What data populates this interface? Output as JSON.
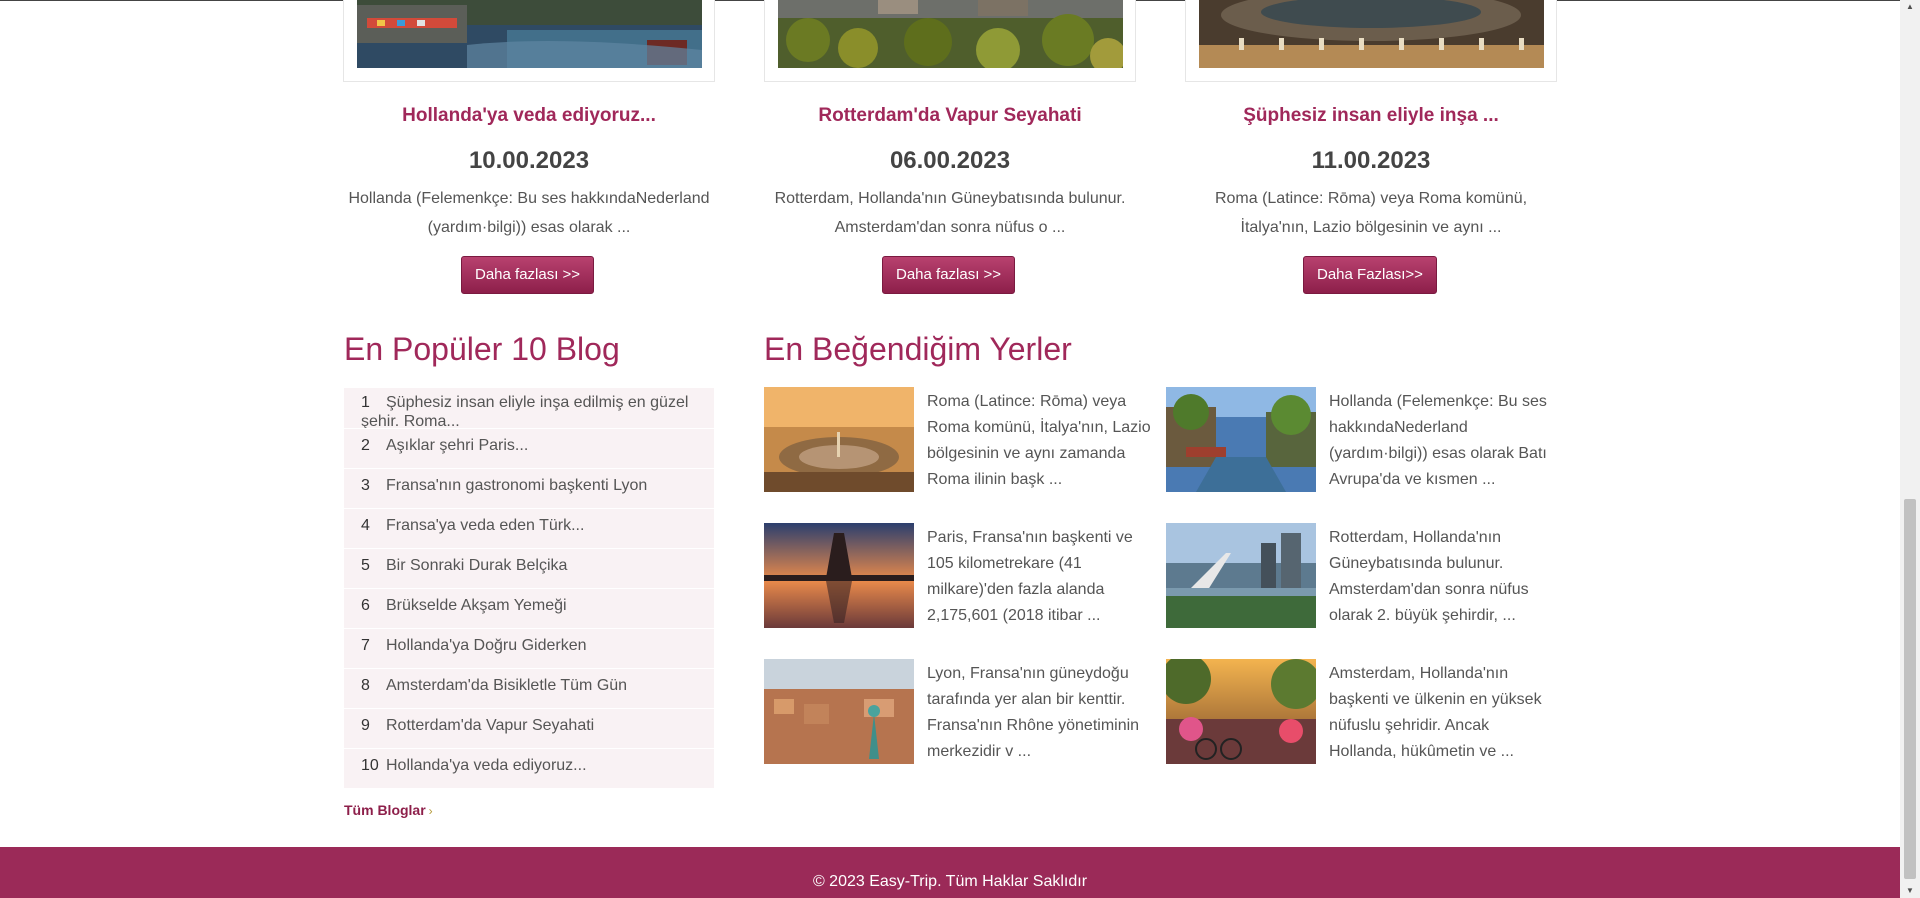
{
  "cards": [
    {
      "title": "Hollanda'ya veda ediyoruz...",
      "date": "10.00.2023",
      "excerpt": "Hollanda (Felemenkçe: Bu ses hakkındaNederland (yardım·bilgi)) esas olarak ...",
      "button": "Daha fazlası >>"
    },
    {
      "title": "Rotterdam'da Vapur Seyahati",
      "date": "06.00.2023",
      "excerpt": "Rotterdam, Hollanda'nın Güneybatısında bulunur. Amsterdam'dan sonra nüfus o ...",
      "button": "Daha fazlası >>"
    },
    {
      "title": "Şüphesiz insan eliyle inşa ...",
      "date": "11.00.2023",
      "excerpt": "Roma (Latince: Rōma) veya Roma komünü, İtalya'nın, Lazio bölgesinin ve aynı ...",
      "button": "Daha Fazlası>>"
    }
  ],
  "popular": {
    "title": "En Popüler 10 Blog",
    "items": [
      {
        "num": "1",
        "text": "Şüphesiz insan eliyle inşa edilmiş en güzel şehir. Roma..."
      },
      {
        "num": "2",
        "text": "Aşıklar şehri Paris..."
      },
      {
        "num": "3",
        "text": "Fransa'nın gastronomi başkenti Lyon"
      },
      {
        "num": "4",
        "text": "Fransa'ya veda eden Türk..."
      },
      {
        "num": "5",
        "text": "Bir Sonraki Durak Belçika"
      },
      {
        "num": "6",
        "text": "Brükselde Akşam Yemeği"
      },
      {
        "num": "7",
        "text": "Hollanda'ya Doğru Giderken"
      },
      {
        "num": "8",
        "text": "Amsterdam'da Bisikletle Tüm Gün"
      },
      {
        "num": "9",
        "text": "Rotterdam'da Vapur Seyahati"
      },
      {
        "num": "10",
        "text": "Hollanda'ya veda ediyoruz..."
      }
    ],
    "all_link": "Tüm Bloglar",
    "all_arrow": "›"
  },
  "favorites": {
    "title": "En Beğendiğim Yerler",
    "items": [
      {
        "text": "Roma (Latince: Rōma) veya Roma komünü, İtalya'nın, Lazio bölgesinin ve aynı zamanda Roma ilinin başk ..."
      },
      {
        "text": "Hollanda (Felemenkçe: Bu ses hakkındaNederland (yardım·bilgi)) esas olarak Batı Avrupa'da ve kısmen ..."
      },
      {
        "text": "Paris, Fransa'nın başkenti ve 105 kilometrekare (41 milkare)'den fazla alanda 2,175,601 (2018 itibar ..."
      },
      {
        "text": "Rotterdam, Hollanda'nın Güneybatısında bulunur. Amsterdam'dan sonra nüfus olarak 2. büyük şehirdir, ..."
      },
      {
        "text": "Lyon, Fransa'nın güneydoğu tarafında yer alan bir kenttir. Fransa'nın Rhône yönetiminin merkezidir v ..."
      },
      {
        "text": "Amsterdam, Hollanda'nın başkenti ve ülkenin en yüksek nüfuslu şehridir. Ancak Hollanda, hükûmetin ve ..."
      }
    ]
  },
  "footer": "© 2023 Easy-Trip. Tüm Haklar Saklıdır",
  "colors": {
    "accent": "#a0285a",
    "footer": "#9b2a58",
    "list_bg": "#f9f2f4"
  }
}
